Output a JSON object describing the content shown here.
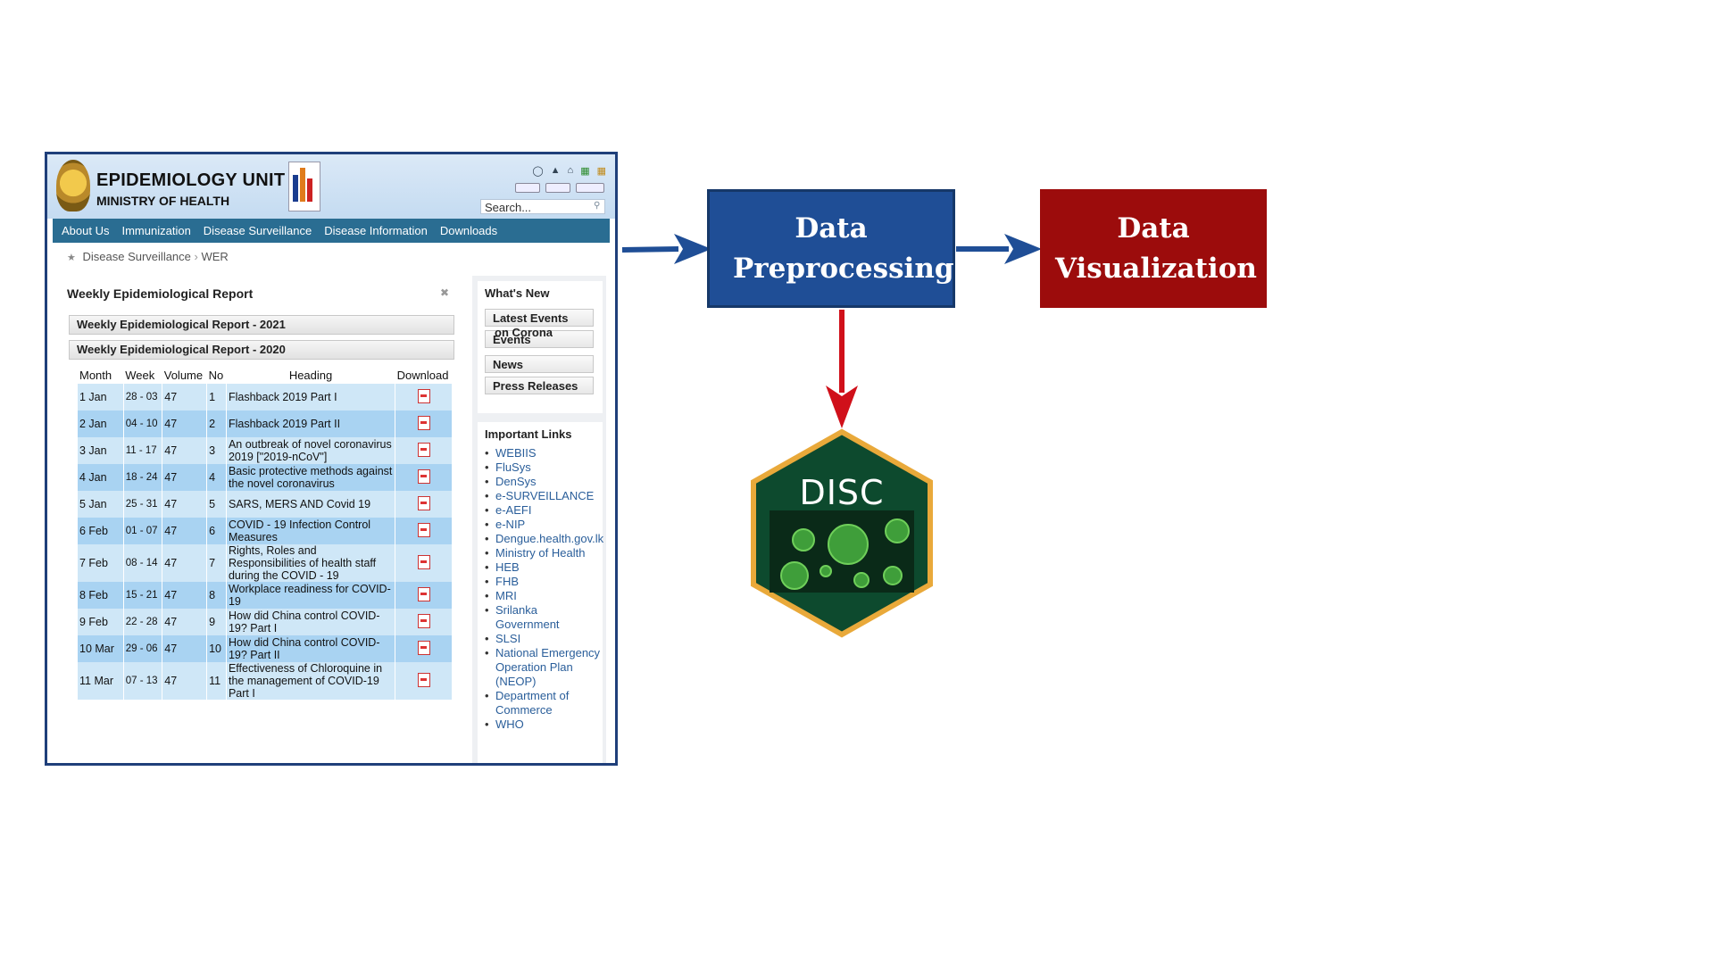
{
  "site": {
    "title": "EPIDEMIOLOGY UNIT",
    "subtitle": "MINISTRY OF HEALTH",
    "search_placeholder": "Search...",
    "nav": [
      "About Us",
      "Immunization",
      "Disease Surveillance",
      "Disease Information",
      "Downloads"
    ],
    "breadcrumb": [
      "Disease Surveillance",
      "WER"
    ],
    "panel_title": "Weekly Epidemiological Report",
    "accordion": [
      "Weekly Epidemiological Report - 2021",
      "Weekly Epidemiological Report - 2020"
    ],
    "table": {
      "headers": [
        "Month",
        "Week",
        "Volume",
        "No",
        "Heading",
        "Download"
      ],
      "rows": [
        {
          "month": "1  Jan",
          "week": "28 - 03",
          "volume": "47",
          "no": "1",
          "heading": "Flashback 2019 Part I"
        },
        {
          "month": "2  Jan",
          "week": "04 - 10",
          "volume": "47",
          "no": "2",
          "heading": "Flashback 2019 Part II"
        },
        {
          "month": "3  Jan",
          "week": "11 - 17",
          "volume": "47",
          "no": "3",
          "heading": "An outbreak of novel coronavirus 2019 [\"2019-nCoV\"]"
        },
        {
          "month": "4  Jan",
          "week": "18 - 24",
          "volume": "47",
          "no": "4",
          "heading": "Basic protective methods against the novel coronavirus"
        },
        {
          "month": "5  Jan",
          "week": "25 - 31",
          "volume": "47",
          "no": "5",
          "heading": "SARS, MERS AND Covid 19"
        },
        {
          "month": "6  Feb",
          "week": "01 - 07",
          "volume": "47",
          "no": "6",
          "heading": "COVID - 19 Infection Control Measures"
        },
        {
          "month": "7  Feb",
          "week": "08 - 14",
          "volume": "47",
          "no": "7",
          "heading": "Rights, Roles and Responsibilities of health staff during the COVID - 19"
        },
        {
          "month": "8  Feb",
          "week": "15 - 21",
          "volume": "47",
          "no": "8",
          "heading": "Workplace readiness for COVID-19"
        },
        {
          "month": "9  Feb",
          "week": "22 - 28",
          "volume": "47",
          "no": "9",
          "heading": "How did China control COVID-19? Part I"
        },
        {
          "month": "10 Mar",
          "week": "29 - 06",
          "volume": "47",
          "no": "10",
          "heading": "How did China control COVID-19? Part II"
        },
        {
          "month": "11 Mar",
          "week": "07 - 13",
          "volume": "47",
          "no": "11",
          "heading": "Effectiveness of Chloroquine in the management of COVID-19 Part I"
        }
      ]
    },
    "whats_new": {
      "title": "What's New",
      "items": [
        "Latest Events",
        "Events",
        "News",
        "Press Releases"
      ],
      "overlap_text": "on Corona"
    },
    "important_links": {
      "title": "Important Links",
      "items": [
        "WEBIIS",
        "FluSys",
        "DenSys",
        "e-SURVEILLANCE",
        "e-AEFI",
        "e-NIP",
        "Dengue.health.gov.lk",
        "Ministry of Health",
        "HEB",
        "FHB",
        "MRI",
        "Srilanka Government",
        "SLSI",
        "National Emergency Operation Plan (NEOP)",
        "Department of Commerce",
        "WHO"
      ]
    }
  },
  "diagram": {
    "preprocessing_label": "Data Preprocessing",
    "visualization_label": "Data Visualization",
    "disc_label": "DISC",
    "colors": {
      "preprocessing": "#1f4e96",
      "visualization": "#9c0c0c",
      "arrow_blue": "#1f4e96",
      "arrow_red": "#d0101a",
      "hex_fill": "#0d4a2e",
      "hex_border": "#e9a93a"
    }
  }
}
